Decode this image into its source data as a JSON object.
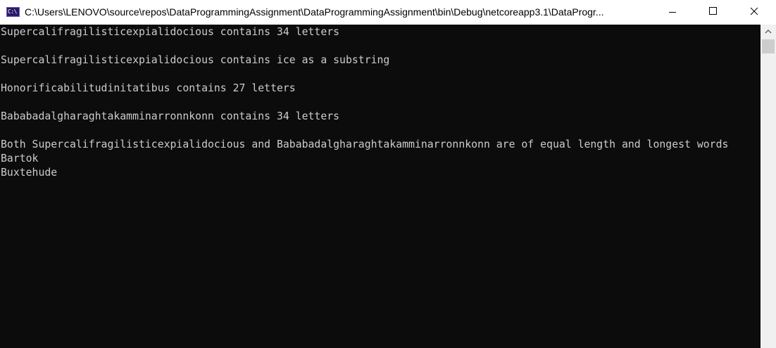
{
  "window": {
    "title": "C:\\Users\\LENOVO\\source\\repos\\DataProgrammingAssignment\\DataProgrammingAssignment\\bin\\Debug\\netcoreapp3.1\\DataProgr...",
    "app_icon_label": "C:\\",
    "app_icon": "console-app-icon",
    "controls": {
      "minimize_icon": "minimize-icon",
      "maximize_icon": "maximize-icon",
      "close_icon": "close-icon"
    }
  },
  "console": {
    "background": "#0c0c0c",
    "foreground": "#cccccc",
    "lines": [
      "Supercalifragilisticexpialidocious contains 34 letters",
      "",
      "Supercalifragilisticexpialidocious contains ice as a substring",
      "",
      "Honorificabilitudinitatibus contains 27 letters",
      "",
      "Bababadalgharaghtakamminarronnkonn contains 34 letters",
      "",
      "Both Supercalifragilisticexpialidocious and Bababadalgharaghtakamminarronnkonn are of equal length and longest words",
      "Bartok",
      "Buxtehude"
    ]
  },
  "scrollbar": {
    "up_arrow_icon": "chevron-up-icon"
  }
}
